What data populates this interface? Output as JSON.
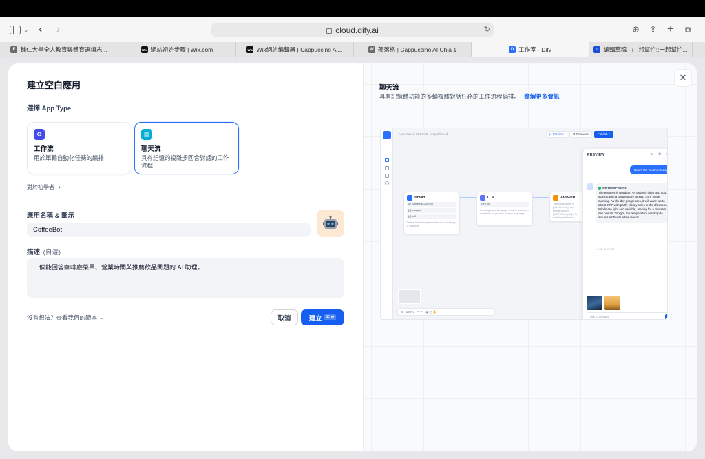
{
  "browser": {
    "url": "cloud.dify.ai",
    "tabs": [
      {
        "label": "輔仁大學全人教育與體育選填志...",
        "fav": "F",
        "color": "#6b6b6b"
      },
      {
        "label": "網站初始步驟 | Wix.com",
        "fav": "Wix",
        "color": "#111111"
      },
      {
        "label": "Wix網站編輯器 | Cappuccino Al...",
        "fav": "Wix",
        "color": "#111111"
      },
      {
        "label": "部落格 | Cappuccino AI Chia 1",
        "fav": "W",
        "color": "#6b6b6b"
      },
      {
        "label": "工作室 - Dify",
        "fav": "D",
        "color": "#2970ff",
        "active": true
      },
      {
        "label": "編輯草稿 - iT 邦幫忙::一起幫忙...",
        "fav": "iT",
        "color": "#1d4ed8"
      }
    ]
  },
  "form": {
    "title": "建立空白應用",
    "app_type_label": "選擇 App Type",
    "cards": [
      {
        "name": "工作流",
        "desc": "用於單輪自動化任務的編排",
        "color": "#444ce7"
      },
      {
        "name": "聊天流",
        "desc": "具有記憶的複雜多回合對話的工作流程",
        "color": "#06aed4"
      }
    ],
    "beginner_link": "對於初學者",
    "name_label": "應用名稱 & 圖示",
    "name_value": "CoffeeBot",
    "desc_label": "描述",
    "desc_optional": "(自選)",
    "desc_value": "一個能回答咖啡廳菜單、營業時間與推薦飲品問題的 AI 助理。",
    "templates_link": "沒有想法？查看我們的範本 →",
    "cancel": "取消",
    "create": "建立",
    "create_kbd": "⌘ ↵"
  },
  "preview": {
    "title": "聊天流",
    "desc": "具有記憶體功能的多輪複雜對話任務的工作流程編排。",
    "more": "瞭解更多資訊",
    "mock": {
      "topline": "Auto-Saved 21:52:55 · Unpublished",
      "btn_preview": "▷ Preview",
      "btn_features": "⚙ Features",
      "btn_publish": "Publish ▾",
      "nodes": {
        "start": "START",
        "start_rows": [
          "{x} name  REQUIRED",
          "{x} images",
          "{x} pdf"
        ],
        "start_text": "Define the initial parameters for launching a workflow",
        "llm": "LLM",
        "llm_model": "GPT-4o",
        "llm_text": "Invoking large language models to answer questions or process natural language",
        "answer": "ANSWER",
        "answer_text": "Today's weather is {{#LLM.text#}} and temperature is {{#HTTP.temp#}} it is suitable entities to extract."
      },
      "zoom": "100%",
      "panel_title": "PREVIEW",
      "user_msg": "How's the weather today",
      "wf_process": "Workflow Process",
      "bot_msg": "The weather in Boydton, VA today is clear and cool, starting with a temperature around 44°F in the morning. As the day progresses, it will warm up to about 73°F with partly cloudy skies in the afternoon. Winds are light and variable, making for a pleasant day overall. Tonight, the temperature will drop to around 50°F with a few clouds.",
      "bot_meta": "9:46 · 1:20 PM",
      "input_placeholder": "Talk to DifyBot"
    }
  }
}
